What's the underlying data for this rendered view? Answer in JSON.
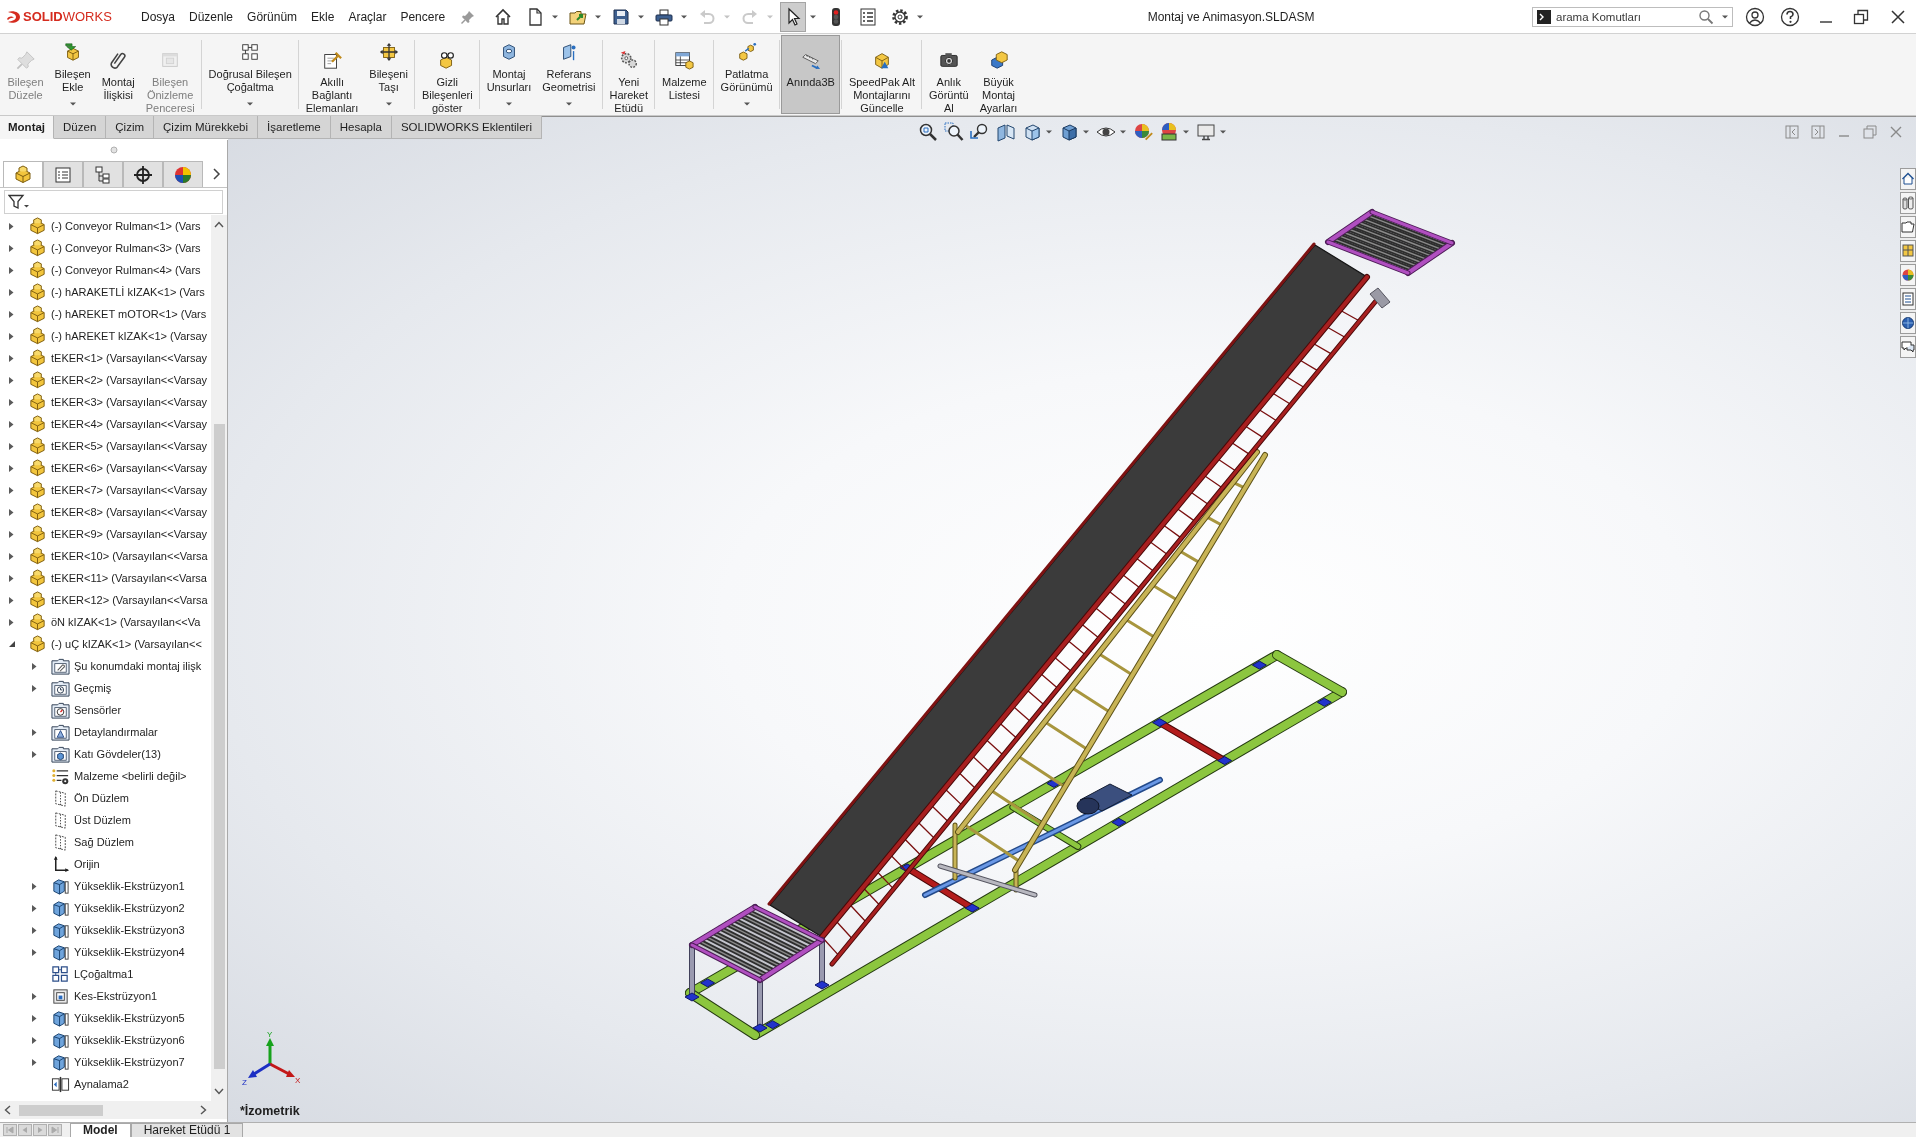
{
  "title_bar": {
    "logo": "**SOLID**WORKS",
    "menu": [
      "Dosya",
      "Düzenle",
      "Görünüm",
      "Ekle",
      "Araçlar",
      "Pencere"
    ],
    "quick_access": [
      {
        "dropdown": false,
        "disabled": false,
        "selected": false
      },
      {
        "dropdown": true,
        "disabled": false,
        "selected": false
      },
      {
        "dropdown": true,
        "disabled": false,
        "selected": false
      },
      {
        "dropdown": true,
        "disabled": false,
        "selected": false
      },
      {
        "dropdown": true,
        "disabled": false,
        "selected": false
      },
      {
        "dropdown": true,
        "disabled": true,
        "selected": false
      },
      {
        "dropdown": true,
        "disabled": true,
        "selected": false
      },
      {
        "dropdown": true,
        "disabled": false,
        "selected": true
      },
      {
        "dropdown": false,
        "disabled": false,
        "selected": false
      },
      {
        "dropdown": false,
        "disabled": false,
        "selected": false
      },
      {
        "dropdown": true,
        "disabled": false,
        "selected": false
      }
    ],
    "document_title": "Montaj ve Animasyon.SLDASM",
    "search": {
      "placeholder": "arama Komutları"
    }
  },
  "command_manager": {
    "buttons": [
      {
        "lines": [
          "Bileşen",
          "Düzele"
        ],
        "disabled": true,
        "selected": false,
        "dropdown": false
      },
      {
        "lines": [
          "Bileşen",
          "Ekle"
        ],
        "disabled": false,
        "selected": false,
        "dropdown": true
      },
      {
        "lines": [
          "Montaj",
          "İlişkisi"
        ],
        "disabled": false,
        "selected": false,
        "dropdown": false
      },
      {
        "lines": [
          "Bileşen",
          "Önizleme",
          "Penceresi"
        ],
        "disabled": true,
        "selected": false,
        "dropdown": false
      },
      {
        "lines": [
          "Doğrusal Bileşen",
          "Çoğaltma"
        ],
        "disabled": false,
        "selected": false,
        "dropdown": true
      },
      {
        "lines": [
          "Akıllı",
          "Bağlantı",
          "Elemanları"
        ],
        "disabled": false,
        "selected": false,
        "dropdown": false
      },
      {
        "lines": [
          "Bileşeni",
          "Taşı"
        ],
        "disabled": false,
        "selected": false,
        "dropdown": true
      },
      {
        "lines": [
          "Gizli",
          "Bileşenleri",
          "göster"
        ],
        "disabled": false,
        "selected": false,
        "dropdown": false
      },
      {
        "lines": [
          "Montaj",
          "Unsurları"
        ],
        "disabled": false,
        "selected": false,
        "dropdown": true
      },
      {
        "lines": [
          "Referans",
          "Geometrisi"
        ],
        "disabled": false,
        "selected": false,
        "dropdown": true
      },
      {
        "lines": [
          "Yeni",
          "Hareket",
          "Etüdü"
        ],
        "disabled": false,
        "selected": false,
        "dropdown": false
      },
      {
        "lines": [
          "Malzeme",
          "Listesi"
        ],
        "disabled": false,
        "selected": false,
        "dropdown": false
      },
      {
        "lines": [
          "Patlatma",
          "Görünümü"
        ],
        "disabled": false,
        "selected": false,
        "dropdown": true
      },
      {
        "lines": [
          "Anında3B"
        ],
        "disabled": false,
        "selected": true,
        "dropdown": false
      },
      {
        "lines": [
          "SpeedPak Alt",
          "Montajlarını",
          "Güncelle"
        ],
        "disabled": false,
        "selected": false,
        "dropdown": false
      },
      {
        "lines": [
          "Anlık",
          "Görüntü",
          "Al"
        ],
        "disabled": false,
        "selected": false,
        "dropdown": false
      },
      {
        "lines": [
          "Büyük",
          "Montaj",
          "Ayarları"
        ],
        "disabled": false,
        "selected": false,
        "dropdown": false
      }
    ],
    "tabs": [
      {
        "label": "Montaj",
        "selected": true
      },
      {
        "label": "Düzen",
        "selected": false
      },
      {
        "label": "Çizim",
        "selected": false
      },
      {
        "label": "Çizim Mürekkebi",
        "selected": false
      },
      {
        "label": "İşaretleme",
        "selected": false
      },
      {
        "label": "Hesapla",
        "selected": false
      },
      {
        "label": "SOLIDWORKS Eklentileri",
        "selected": false
      }
    ]
  },
  "view_toolbar": [
    {
      "dropdown": false
    },
    {
      "dropdown": false
    },
    {
      "dropdown": false
    },
    {
      "dropdown": false
    },
    {
      "dropdown": true
    },
    {
      "dropdown": true
    },
    {
      "dropdown": true
    },
    {
      "dropdown": false
    },
    {
      "dropdown": true
    },
    {
      "dropdown": true
    }
  ],
  "feature_manager": {
    "panel_tabs": [
      {
        "selected": true
      },
      {
        "selected": false
      },
      {
        "selected": false
      },
      {
        "selected": false
      },
      {
        "selected": false
      }
    ],
    "items": [
      {
        "label": "(-) Conveyor Rulman<1> (Vars",
        "kind": "part",
        "expanded": false
      },
      {
        "label": "(-) Conveyor Rulman<3> (Vars",
        "kind": "part",
        "expanded": false
      },
      {
        "label": "(-) Conveyor Rulman<4> (Vars",
        "kind": "part",
        "expanded": false
      },
      {
        "label": "(-) hARAKETLİ kIZAK<1> (Vars",
        "kind": "part",
        "expanded": false
      },
      {
        "label": "(-) hAREKET mOTOR<1> (Vars",
        "kind": "part",
        "expanded": false
      },
      {
        "label": "(-) hAREKET kIZAK<1> (Varsay",
        "kind": "part",
        "expanded": false
      },
      {
        "label": "tEKER<1> (Varsayılan<<Varsay",
        "kind": "part",
        "expanded": false
      },
      {
        "label": "tEKER<2> (Varsayılan<<Varsay",
        "kind": "part",
        "expanded": false
      },
      {
        "label": "tEKER<3> (Varsayılan<<Varsay",
        "kind": "part",
        "expanded": false
      },
      {
        "label": "tEKER<4> (Varsayılan<<Varsay",
        "kind": "part",
        "expanded": false
      },
      {
        "label": "tEKER<5> (Varsayılan<<Varsay",
        "kind": "part",
        "expanded": false
      },
      {
        "label": "tEKER<6> (Varsayılan<<Varsay",
        "kind": "part",
        "expanded": false
      },
      {
        "label": "tEKER<7> (Varsayılan<<Varsay",
        "kind": "part",
        "expanded": false
      },
      {
        "label": "tEKER<8> (Varsayılan<<Varsay",
        "kind": "part",
        "expanded": false
      },
      {
        "label": "tEKER<9> (Varsayılan<<Varsay",
        "kind": "part",
        "expanded": false
      },
      {
        "label": "tEKER<10> (Varsayılan<<Varsa",
        "kind": "part",
        "expanded": false
      },
      {
        "label": "tEKER<11> (Varsayılan<<Varsa",
        "kind": "part",
        "expanded": false
      },
      {
        "label": "tEKER<12> (Varsayılan<<Varsa",
        "kind": "part",
        "expanded": false
      },
      {
        "label": "öN kIZAK<1> (Varsayılan<<Va",
        "kind": "part",
        "expanded": false
      },
      {
        "label": "(-) uÇ kIZAK<1> (Varsayılan<<",
        "kind": "part",
        "expanded": true,
        "children": [
          {
            "label": "Şu konumdaki montaj ilişk",
            "kind": "mates",
            "expanded": false
          },
          {
            "label": "Geçmiş",
            "kind": "history",
            "expanded": false
          },
          {
            "label": "Sensörler",
            "kind": "sensors"
          },
          {
            "label": "Detaylandırmalar",
            "kind": "annotations",
            "expanded": false
          },
          {
            "label": "Katı Gövdeler(13)",
            "kind": "bodies",
            "expanded": false
          },
          {
            "label": "Malzeme <belirli değil>",
            "kind": "material"
          },
          {
            "label": "Ön Düzlem",
            "kind": "plane"
          },
          {
            "label": "Üst Düzlem",
            "kind": "plane"
          },
          {
            "label": "Sağ Düzlem",
            "kind": "plane"
          },
          {
            "label": "Orijin",
            "kind": "origin"
          },
          {
            "label": "Yükseklik-Ekstrüzyon1",
            "kind": "extrude",
            "expanded": false
          },
          {
            "label": "Yükseklik-Ekstrüzyon2",
            "kind": "extrude",
            "expanded": false
          },
          {
            "label": "Yükseklik-Ekstrüzyon3",
            "kind": "extrude",
            "expanded": false
          },
          {
            "label": "Yükseklik-Ekstrüzyon4",
            "kind": "extrude",
            "expanded": false
          },
          {
            "label": "LÇoğaltma1",
            "kind": "pattern"
          },
          {
            "label": "Kes-Ekstrüzyon1",
            "kind": "cut",
            "expanded": false
          },
          {
            "label": "Yükseklik-Ekstrüzyon5",
            "kind": "extrude",
            "expanded": false
          },
          {
            "label": "Yükseklik-Ekstrüzyon6",
            "kind": "extrude",
            "expanded": false
          },
          {
            "label": "Yükseklik-Ekstrüzyon7",
            "kind": "extrude",
            "expanded": false
          },
          {
            "label": "Aynalama2",
            "kind": "mirror"
          }
        ]
      }
    ]
  },
  "graphics": {
    "triad": {
      "y": "Y",
      "z": "Z",
      "x": "X"
    },
    "view_label": "*İzometrik"
  },
  "bottom_tabs": [
    {
      "label": "Model",
      "selected": true
    },
    {
      "label": "Hareket Etüdü 1",
      "selected": false
    }
  ]
}
